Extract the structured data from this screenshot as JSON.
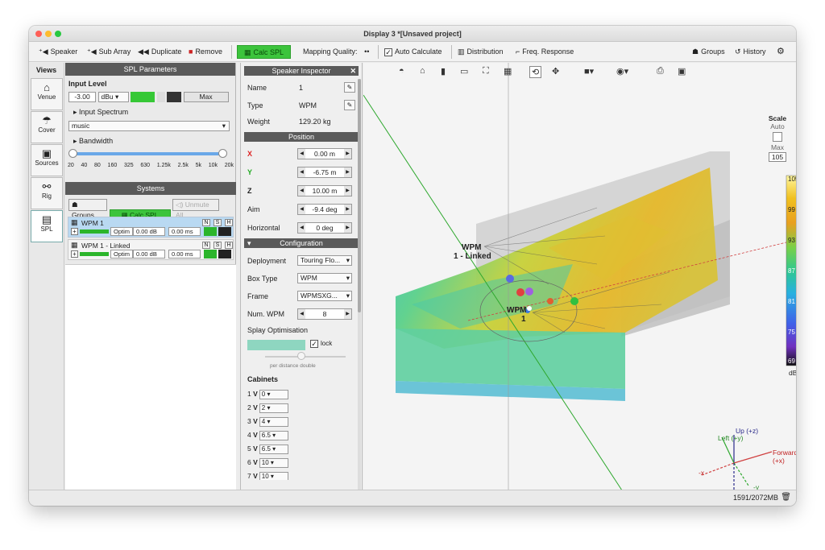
{
  "window": {
    "title": "Display 3 *[Unsaved project]"
  },
  "toolbar": {
    "speaker": "Speaker",
    "sub_array": "Sub Array",
    "duplicate": "Duplicate",
    "remove": "Remove",
    "calc_spl": "Calc SPL",
    "mapping_quality": "Mapping Quality:",
    "mapping_quality_value": "••",
    "auto_calculate": "Auto Calculate",
    "distribution": "Distribution",
    "freq_response": "Freq. Response",
    "groups": "Groups",
    "history": "History"
  },
  "views": {
    "title": "Views",
    "items": [
      {
        "label": "Venue",
        "icon": "house-icon"
      },
      {
        "label": "Cover",
        "icon": "umbrella-icon"
      },
      {
        "label": "Sources",
        "icon": "speaker-icon"
      },
      {
        "label": "Rig",
        "icon": "rig-icon"
      },
      {
        "label": "SPL",
        "icon": "spl-icon"
      }
    ]
  },
  "spl": {
    "title": "SPL Parameters",
    "input_level": "Input Level",
    "level_value": "-3.00",
    "unit": "dBu",
    "max": "Max",
    "input_spectrum": "Input Spectrum",
    "spectrum": "music",
    "bandwidth": "Bandwidth",
    "freq_ticks": [
      "20",
      "40",
      "80",
      "160",
      "325",
      "630",
      "1.25k",
      "2.5k",
      "5k",
      "10k",
      "20k"
    ]
  },
  "systems": {
    "title": "Systems",
    "groups": "Groups..",
    "calc_spl": "Calc SPL",
    "unmute_all": "Unmute All",
    "rows": [
      {
        "name": "WPM 1",
        "optim": "Optim",
        "gain": "0.00 dB",
        "delay": "0.00 ms",
        "n": "N",
        "s": "S",
        "h": "H"
      },
      {
        "name": "WPM 1 - Linked",
        "optim": "Optim",
        "gain": "0.00 dB",
        "delay": "0.00 ms",
        "n": "N",
        "s": "S",
        "h": "H"
      }
    ]
  },
  "inspector": {
    "title": "Speaker Inspector",
    "name_label": "Name",
    "name": "1",
    "type_label": "Type",
    "type": "WPM",
    "weight_label": "Weight",
    "weight": "129.20 kg",
    "position_title": "Position",
    "x_label": "X",
    "x": "0.00 m",
    "y_label": "Y",
    "y": "-6.75 m",
    "z_label": "Z",
    "z": "10.00 m",
    "aim_label": "Aim",
    "aim": "-9.4 deg",
    "horizontal_label": "Horizontal",
    "horizontal": "0 deg",
    "config_title": "Configuration",
    "deployment_label": "Deployment",
    "deployment": "Touring Flo...",
    "boxtype_label": "Box Type",
    "boxtype": "WPM",
    "frame_label": "Frame",
    "frame": "WPMSXG...",
    "num_label": "Num. WPM",
    "num": "8",
    "splay_title": "Splay Optimisation",
    "lock": "lock",
    "per_distance": "per distance double",
    "cabinets_title": "Cabinets",
    "cabinets": [
      {
        "n": "1",
        "v": "0"
      },
      {
        "n": "2",
        "v": "2"
      },
      {
        "n": "3",
        "v": "4"
      },
      {
        "n": "4",
        "v": "6.5"
      },
      {
        "n": "5",
        "v": "6.5"
      },
      {
        "n": "6",
        "v": "10"
      },
      {
        "n": "7",
        "v": "10"
      }
    ]
  },
  "viewport": {
    "wpm_label": "WPM",
    "linked_label": "1 - Linked",
    "wpm_label2": "WPM",
    "wpm_num": "1",
    "axes": {
      "up": "Up (+z)",
      "left": "Left (+y)",
      "forward": "Forward (+x)",
      "minus_x": "-x",
      "minus_y": "-y",
      "minus_z": "-z"
    }
  },
  "scale": {
    "title": "Scale",
    "auto": "Auto",
    "max": "Max",
    "max_value": "105",
    "ticks": [
      "105",
      "99",
      "93",
      "87",
      "81",
      "75",
      "69"
    ],
    "unit": "dB"
  },
  "status": {
    "memory": "1591/2072MB"
  },
  "colors": {
    "accent_green": "#3cc43c",
    "panel_dark": "#5a5a5a",
    "selected_row": "#b9d9f2"
  }
}
